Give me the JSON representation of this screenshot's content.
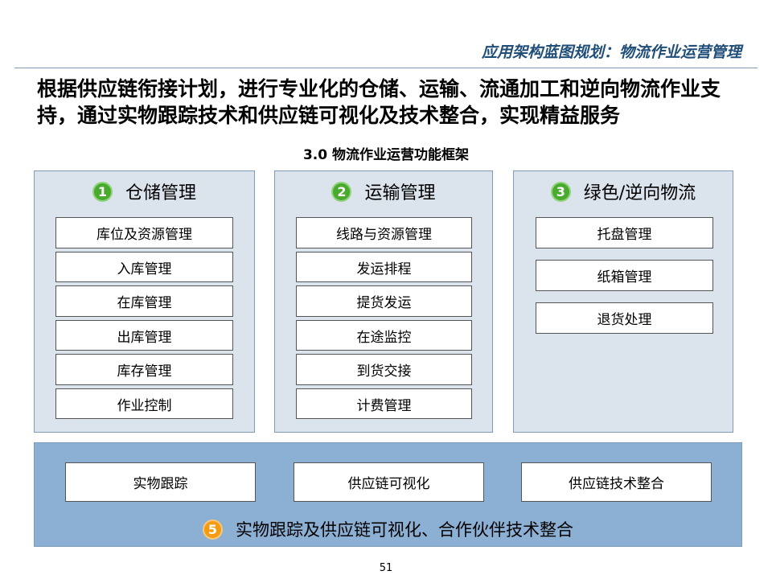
{
  "header": {
    "title": "应用架构蓝图规划：物流作业运营管理"
  },
  "headline": "根据供应链衔接计划，进行专业化的仓储、运输、流通加工和逆向物流作业支持，通过实物跟踪技术和供应链可视化及技术整合，实现精益服务",
  "framework_title": "3.0 物流作业运营功能框架",
  "colors": {
    "number_green": "#4aaa2f",
    "number_orange": "#f39c12",
    "module_bg": "#dbe3ec",
    "bottom_bg": "#8cafd4",
    "header_blue": "#1f4e79"
  },
  "modules": [
    {
      "number": "1",
      "title": "仓储管理",
      "items": [
        "库位及资源管理",
        "入库管理",
        "在库管理",
        "出库管理",
        "库存管理",
        "作业控制"
      ]
    },
    {
      "number": "2",
      "title": "运输管理",
      "items": [
        "线路与资源管理",
        "发运排程",
        "提货发运",
        "在途监控",
        "到货交接",
        "计费管理"
      ]
    },
    {
      "number": "3",
      "title": "绿色/逆向物流",
      "items": [
        "托盘管理",
        "纸箱管理",
        "退货处理"
      ]
    }
  ],
  "bottom": {
    "items": [
      "实物跟踪",
      "供应链可视化",
      "供应链技术整合"
    ],
    "number": "5",
    "title": "实物跟踪及供应链可视化、合作伙伴技术整合"
  },
  "page_number": "51"
}
